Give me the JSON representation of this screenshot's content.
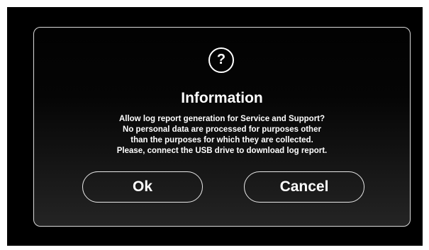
{
  "dialog": {
    "icon": "question-icon",
    "icon_glyph": "?",
    "title": "Information",
    "message_lines": [
      "Allow log report generation for Service and Support?",
      "No personal data are processed for purposes other",
      "than the purposes for which they are collected.",
      "Please, connect the USB drive to download log report."
    ],
    "ok_label": "Ok",
    "cancel_label": "Cancel"
  },
  "colors": {
    "background": "#000000",
    "text": "#ffffff",
    "border": "#d9d9d9"
  }
}
